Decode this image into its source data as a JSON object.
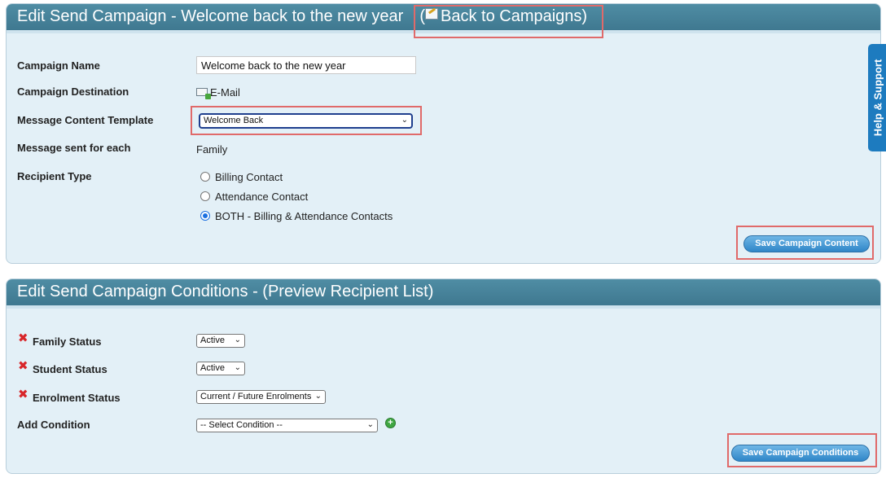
{
  "campaign_panel": {
    "title": "Edit Send Campaign - Welcome back to the new year",
    "back_link": "Back to Campaigns",
    "fields": {
      "campaign_name_label": "Campaign Name",
      "campaign_name_value": "Welcome back to the new year",
      "destination_label": "Campaign Destination",
      "destination_value": "E-Mail",
      "template_label": "Message Content Template",
      "template_selected": "Welcome Back",
      "sent_for_label": "Message sent for each",
      "sent_for_value": "Family",
      "recipient_type_label": "Recipient Type"
    },
    "recipient_options": [
      {
        "label": "Billing Contact",
        "checked": false
      },
      {
        "label": "Attendance Contact",
        "checked": false
      },
      {
        "label": "BOTH - Billing & Attendance Contacts",
        "checked": true
      }
    ],
    "save_button": "Save Campaign Content"
  },
  "conditions_panel": {
    "title": "Edit Send Campaign Conditions - (Preview Recipient List)",
    "conditions": [
      {
        "label": "Family Status",
        "value": "Active"
      },
      {
        "label": "Student Status",
        "value": "Active"
      },
      {
        "label": "Enrolment Status",
        "value": "Current / Future Enrolments"
      }
    ],
    "add_condition_label": "Add Condition",
    "add_condition_placeholder": "-- Select Condition --",
    "save_button": "Save Campaign Conditions"
  },
  "help_tab": "Help & Support",
  "colors": {
    "header": "#4a88a0",
    "panel_bg": "#e3f0f7",
    "annotation": "#e06a6a",
    "button": "#2f86c8",
    "remove": "#d8262a",
    "add": "#3fa642",
    "help_tab": "#1d7bbf"
  },
  "icons": {
    "back_link": "edit-icon",
    "destination": "email-icon",
    "remove_condition": "red-x-icon",
    "add_condition": "plus-circle-icon"
  }
}
